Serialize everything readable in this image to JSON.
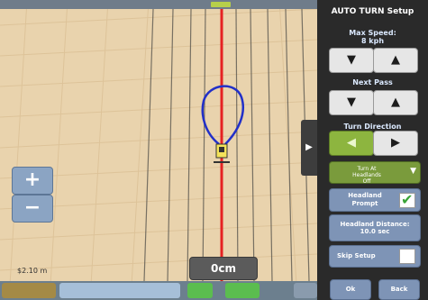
{
  "map": {
    "scale_text": "$2.10 m",
    "offset_value": "0cm",
    "side_tab_glyph": "▶",
    "colors": {
      "field": "#e9d3ad",
      "guidance_line": "#e52222",
      "turn_path": "#2230c8",
      "swath_lines": "#514f4a"
    }
  },
  "zoom": {
    "zoom_in_label": "+",
    "zoom_out_label": "−"
  },
  "panel": {
    "title": "AUTO TURN Setup",
    "max_speed_label": "Max Speed:",
    "max_speed_value": "8 kph",
    "decrease_glyph": "▼",
    "increase_glyph": "▲",
    "next_pass_label": "Next Pass",
    "turn_direction_label": "Turn Direction",
    "left_glyph": "◀",
    "right_glyph": "▶",
    "turn_at_headlands_line1": "Turn At",
    "turn_at_headlands_line2": "Headlands",
    "turn_at_headlands_line3": "Off",
    "dropdown_glyph": "▼",
    "headland_prompt_line1": "Headland",
    "headland_prompt_line2": "Prompt",
    "headland_prompt_checked": true,
    "headland_distance_line1": "Headland Distance:",
    "headland_distance_line2": "10.0 sec",
    "skip_setup_label": "Skip Setup",
    "skip_setup_checked": false,
    "ok_label": "Ok",
    "back_label": "Back"
  }
}
